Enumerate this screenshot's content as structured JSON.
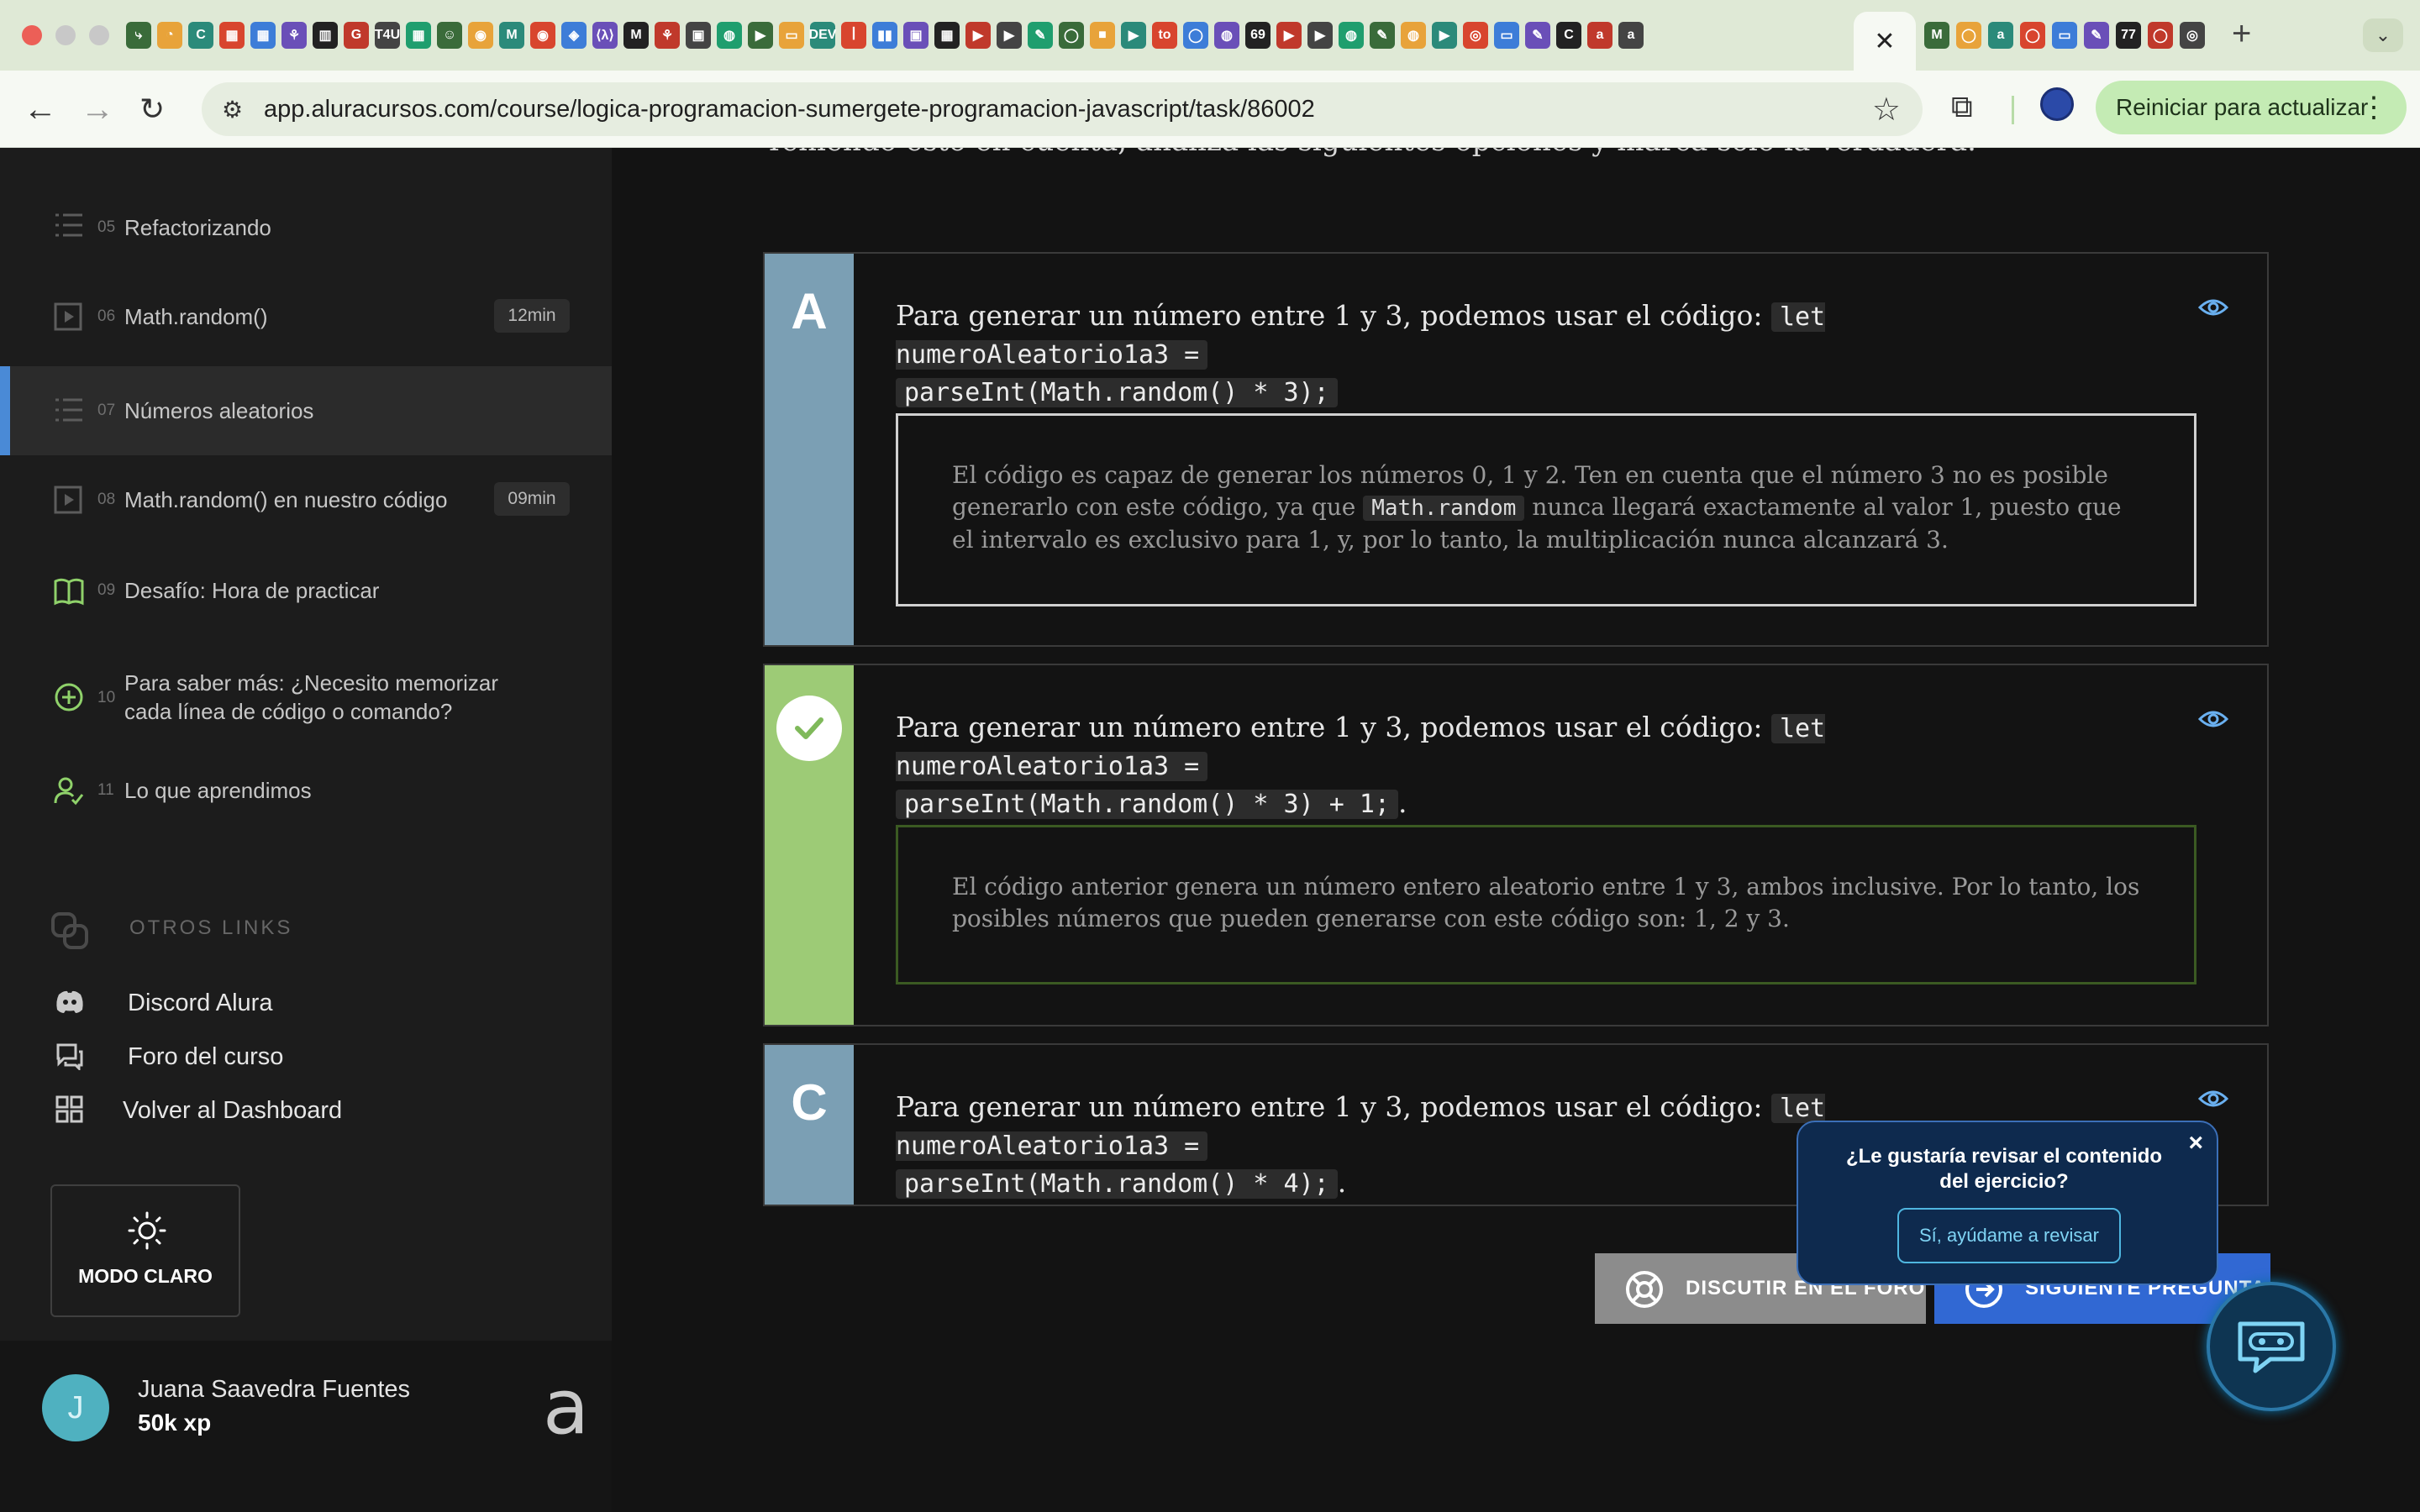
{
  "browser": {
    "active_tab_close": "✕",
    "new_tab": "+",
    "tab_search": "⌄",
    "url": "app.aluracursos.com/course/logica-programacion-sumergete-programacion-javascript/task/86002",
    "update_button": "Reiniciar para actualizar",
    "update_menu": "⋮",
    "favicons": [
      "⤷",
      "◔",
      "C",
      "▦",
      "▦",
      "⚘",
      "▥",
      "G",
      "T4U",
      "▦",
      "☺",
      "◉",
      "M",
      "◉",
      "◈",
      "⟨λ⟩",
      "M",
      "⚘",
      "▣",
      "◍",
      "▶",
      "▭",
      "DEV",
      "ꟾ",
      "▮▮",
      "▣",
      "▦",
      "▶",
      "▶",
      "✎",
      "◯",
      "■",
      "▶",
      "to",
      "◯",
      "◍",
      "69",
      "▶",
      "▶",
      "◍",
      "✎",
      "◍",
      "▶",
      "◎",
      "▭",
      "✎",
      "C",
      "a",
      "a"
    ],
    "favicons_right": [
      "M",
      "◯",
      "a",
      "◯",
      "▭",
      "✎",
      "77",
      "◯",
      "◎"
    ]
  },
  "sidebar": {
    "lessons": [
      {
        "num": "05",
        "title": "Refactorizando",
        "icon": "list-icon",
        "duration": ""
      },
      {
        "num": "06",
        "title": "Math.random()",
        "icon": "video-icon",
        "duration": "12min"
      },
      {
        "num": "07",
        "title": "Números aleatorios",
        "icon": "list-icon",
        "duration": "",
        "active": true
      },
      {
        "num": "08",
        "title": "Math.random() en nuestro código",
        "icon": "video-icon",
        "duration": "09min"
      },
      {
        "num": "09",
        "title": "Desafío: Hora de practicar",
        "icon": "book-icon",
        "duration": ""
      },
      {
        "num": "10",
        "title_line1": "Para saber más: ¿Necesito memorizar",
        "title_line2": "cada línea de código o comando?",
        "icon": "plus-circle-icon",
        "duration": ""
      },
      {
        "num": "11",
        "title": "Lo que aprendimos",
        "icon": "user-check-icon",
        "duration": ""
      }
    ],
    "other_links_heading": "OTROS LINKS",
    "links": [
      {
        "label": "Discord Alura",
        "icon": "discord-icon"
      },
      {
        "label": "Foro del curso",
        "icon": "forum-icon"
      },
      {
        "label": "Volver al Dashboard",
        "icon": "dashboard-icon"
      }
    ],
    "mode_button": "MODO CLARO",
    "user": {
      "initial": "J",
      "name": "Juana Saavedra Fuentes",
      "xp": "50k xp"
    },
    "logo": "a"
  },
  "main": {
    "question": "Teniendo esto en cuenta, analiza las siguientes opciones y marca solo la verdadera.",
    "options": [
      {
        "letter": "A",
        "text": "Para generar un número entre 1 y 3, podemos usar el código: ",
        "code_line1": "let numeroAleatorio1a3 =",
        "code_line2": "parseInt(Math.random() * 3);",
        "suffix": "",
        "feedback_before": "El código es capaz de generar los números 0, 1 y 2. Ten en cuenta que el número 3 no es posible generarlo con este código, ya que ",
        "feedback_code": "Math.random",
        "feedback_after": " nunca llegará exactamente al valor 1, puesto que el intervalo es exclusivo para 1, y, por lo tanto, la multiplicación nunca alcanzará 3.",
        "side_color": "#7b9fb4"
      },
      {
        "letter": "",
        "text": "Para generar un número entre 1 y 3, podemos usar el código: ",
        "code_line1": "let numeroAleatorio1a3 =",
        "code_line2": "parseInt(Math.random() * 3) + 1;",
        "suffix": ".",
        "feedback_before": "El código anterior genera un número entero aleatorio entre 1 y 3, ambos inclusive. Por lo tanto, los posibles números que pueden generarse con este código son: 1, 2 y 3.",
        "side_color": "#9dcb76",
        "correct": true
      },
      {
        "letter": "C",
        "text": "Para generar un número entre 1 y 3, podemos usar el código: ",
        "code_line1": "let numeroAleatorio1a3 =",
        "code_line2": "parseInt(Math.random() * 4);",
        "suffix": ".",
        "side_color": "#7b9fb4"
      }
    ],
    "forum_button": "DISCUTIR EN EL FORO",
    "next_button": "SIGUIENTE PREGUNTA"
  },
  "popup": {
    "question": "¿Le gustaría revisar el contenido del ejercicio?",
    "accept": "Sí, ayúdame a revisar",
    "close": "×"
  },
  "colors": {
    "accent_blue": "#3168d3",
    "correct_green": "#9dcb76",
    "option_side": "#7b9fb4",
    "sidebar_bg": "#1c1c1c",
    "main_bg": "#131313"
  }
}
